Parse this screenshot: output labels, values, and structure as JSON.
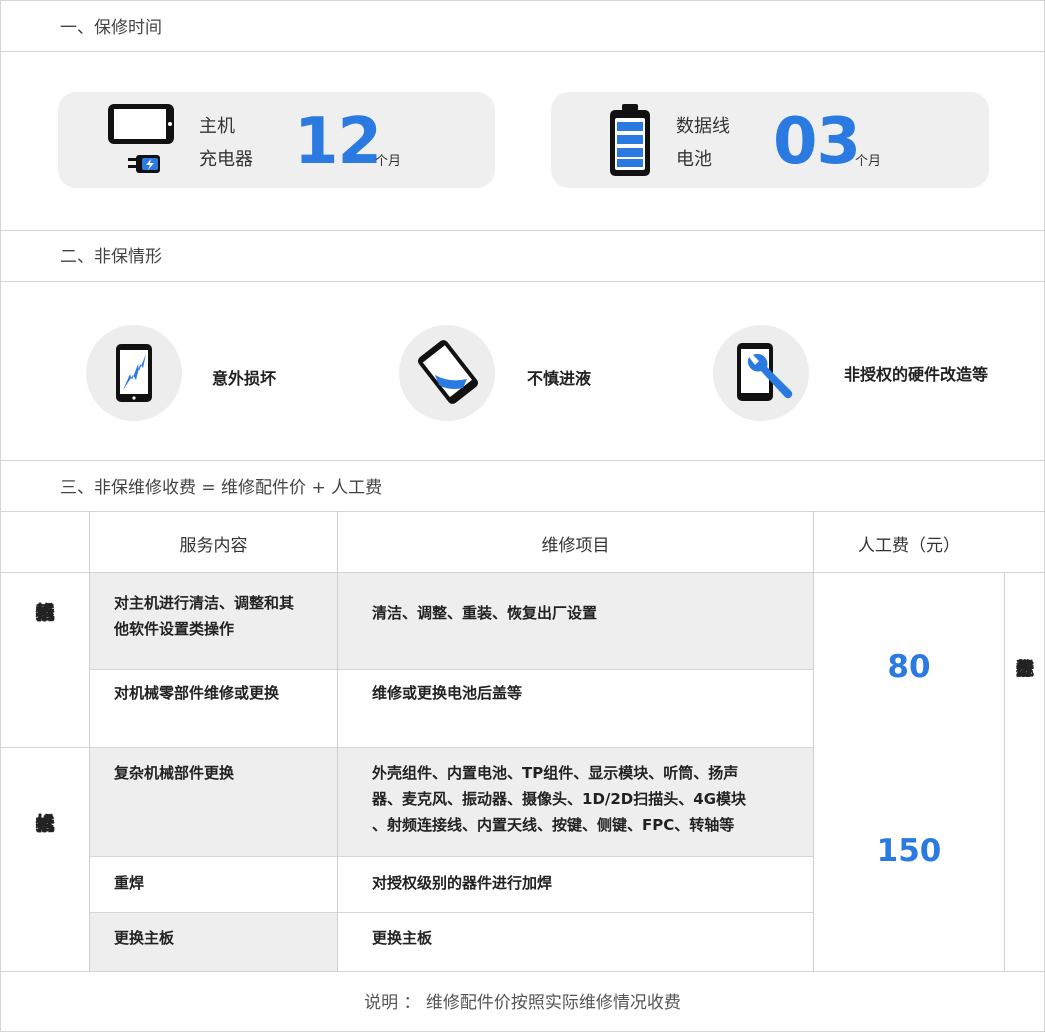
{
  "sections": {
    "warranty_title": "一、保修时间",
    "non_warranty_title": "二、非保情形",
    "fee_title": "三、非保维修收费 = 维修配件价 + 人工费"
  },
  "warranty": {
    "card1": {
      "label_line1": "主机",
      "label_line2": "充电器",
      "value": "12",
      "unit": "个月",
      "icons": [
        "phone-icon",
        "charger-icon"
      ]
    },
    "card2": {
      "label_line1": "数据线",
      "label_line2": "电池",
      "value": "03",
      "unit": "个月",
      "icons": [
        "battery-icon"
      ]
    }
  },
  "non_warranty": {
    "items": [
      {
        "label": "意外损坏",
        "icon": "cracked-phone-icon"
      },
      {
        "label": "不慎进液",
        "icon": "liquid-phone-icon"
      },
      {
        "label": "非授权的硬件改造等",
        "icon": "wrench-phone-icon"
      }
    ]
  },
  "table": {
    "headers": {
      "service": "服务内容",
      "items": "维修项目",
      "fee": "人工费（元）"
    },
    "group1": {
      "label": [
        "不",
        "拆",
        "机",
        "维",
        "修"
      ],
      "rows": [
        {
          "service_line1": "对主机进行清洁、调整和其",
          "service_line2": "他软件设置类操作",
          "items_line1": "清洁、调整、重装、恢复出厂设置"
        },
        {
          "service_line1": "对机械零部件维修或更换",
          "items_line1": "维修或更换电池后盖等"
        }
      ],
      "fee": "80"
    },
    "group2": {
      "label": [
        "拆",
        "机",
        "维",
        "修"
      ],
      "rows": [
        {
          "service_line1": "复杂机械部件更换",
          "items_line1": "外壳组件、内置电池、TP组件、显示模块、听筒、扬声",
          "items_line2": "器、麦克风、振动器、摄像头、1D/2D扫描头、4G模块",
          "items_line3": "、射频连接线、内置天线、按键、侧键、FPC、转轴等"
        },
        {
          "service_line1": "重焊",
          "items_line1": "对授权级别的器件进行加焊"
        },
        {
          "service_line1": "更换主板",
          "items_line1": "更换主板"
        }
      ],
      "fee": "150"
    },
    "standard": [
      "罗",
      "丹",
      "贝",
      "尔",
      "统",
      "一",
      "人",
      "工",
      "标",
      "准"
    ]
  },
  "note": "说明 ： 维修配件价按照实际维修情况收费",
  "colors": {
    "accent": "#2a7ae2",
    "card_bg": "#efefef",
    "gray_cell": "#eeeeee",
    "border": "#d4d4d4"
  }
}
